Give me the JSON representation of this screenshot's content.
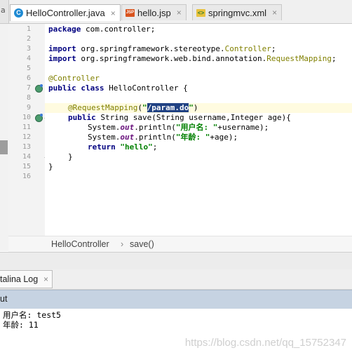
{
  "tabs": [
    {
      "label": "HelloController.java",
      "icon": "java-class-icon",
      "active": true
    },
    {
      "label": "hello.jsp",
      "icon": "jsp-file-icon",
      "active": false
    },
    {
      "label": "springmvc.xml",
      "icon": "xml-file-icon",
      "active": false
    }
  ],
  "left_stub_label": "a",
  "close_glyph": "×",
  "editor": {
    "line_numbers": [
      "1",
      "2",
      "3",
      "4",
      "5",
      "6",
      "7",
      "8",
      "9",
      "10",
      "11",
      "12",
      "13",
      "14",
      "15",
      "16"
    ],
    "code": {
      "l1_kw": "package",
      "l1_rest": " com.controller;",
      "l3_kw": "import",
      "l3_pkg": " org.springframework.stereotype.",
      "l3_cls": "Controller",
      "l3_end": ";",
      "l4_kw": "import",
      "l4_pkg": " org.springframework.web.bind.annotation.",
      "l4_cls": "RequestMapping",
      "l4_end": ";",
      "l6_ann": "@Controller",
      "l7_kw": "public class",
      "l7_rest": " HelloController {",
      "l9_ann": "@RequestMapping",
      "l9_open": "(",
      "l9_q1": "\"",
      "l9_sel": "/param.do",
      "l9_q2": "\"",
      "l9_close": ")",
      "l10_kw": "public",
      "l10_rest": " String save(String username,Integer age){",
      "l11_a": "System.",
      "l11_out": "out",
      "l11_b": ".println(",
      "l11_str": "\"用户名: \"",
      "l11_c": "+username);",
      "l12_a": "System.",
      "l12_out": "out",
      "l12_b": ".println(",
      "l12_str": "\"年龄: \"",
      "l12_c": "+age);",
      "l13_kw": "return",
      "l13_str": " \"hello\"",
      "l13_end": ";",
      "l14": "}",
      "l15": "}"
    }
  },
  "breadcrumb": {
    "class": "HelloController",
    "separator": "›",
    "method": "save()"
  },
  "run_panel": {
    "tab_label": "talina Log",
    "output_label": "ut",
    "console_lines": [
      "用户名: test5",
      "年龄: 11"
    ],
    "watermark": "https://blog.csdn.net/qq_15752347"
  },
  "colors": {
    "keyword": "#000080",
    "annotation": "#808000",
    "string": "#008000",
    "static_field": "#660e7a",
    "selection": "#214283",
    "highlight_line": "#fffbe0",
    "output_header": "#c6d3e2"
  }
}
